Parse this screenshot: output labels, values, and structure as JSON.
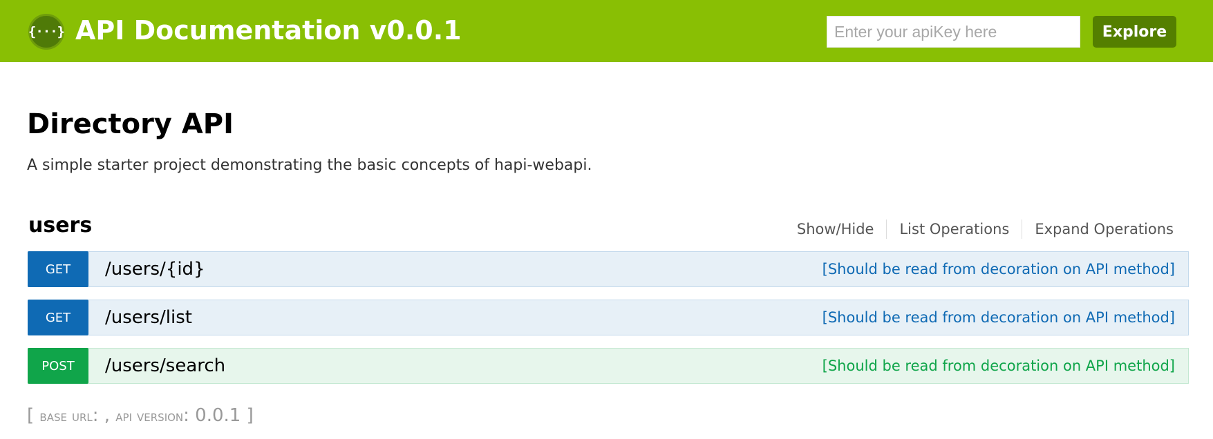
{
  "header": {
    "logo_glyph": "{···}",
    "title": "API Documentation v0.0.1",
    "apikey_placeholder": "Enter your apiKey here",
    "explore_label": "Explore",
    "colors": {
      "background": "#89bf04",
      "button": "#547f00"
    }
  },
  "info": {
    "title": "Directory API",
    "description": "A simple starter project demonstrating the basic concepts of hapi-webapi."
  },
  "resource": {
    "name": "users",
    "links": [
      "Show/Hide",
      "List Operations",
      "Expand Operations"
    ],
    "operations": [
      {
        "method": "GET",
        "path": "/users/{id}",
        "summary": "[Should be read from decoration on API method]"
      },
      {
        "method": "GET",
        "path": "/users/list",
        "summary": "[Should be read from decoration on API method]"
      },
      {
        "method": "POST",
        "path": "/users/search",
        "summary": "[Should be read from decoration on API method]"
      }
    ]
  },
  "footer": {
    "open_bracket": "[",
    "base_url_label": "base url",
    "base_url_value": ": ,",
    "api_version_label": "api version",
    "api_version_value": ": 0.0.1",
    "close_bracket": "]"
  },
  "method_colors": {
    "GET": "#0f6ab4",
    "POST": "#10a54a"
  }
}
